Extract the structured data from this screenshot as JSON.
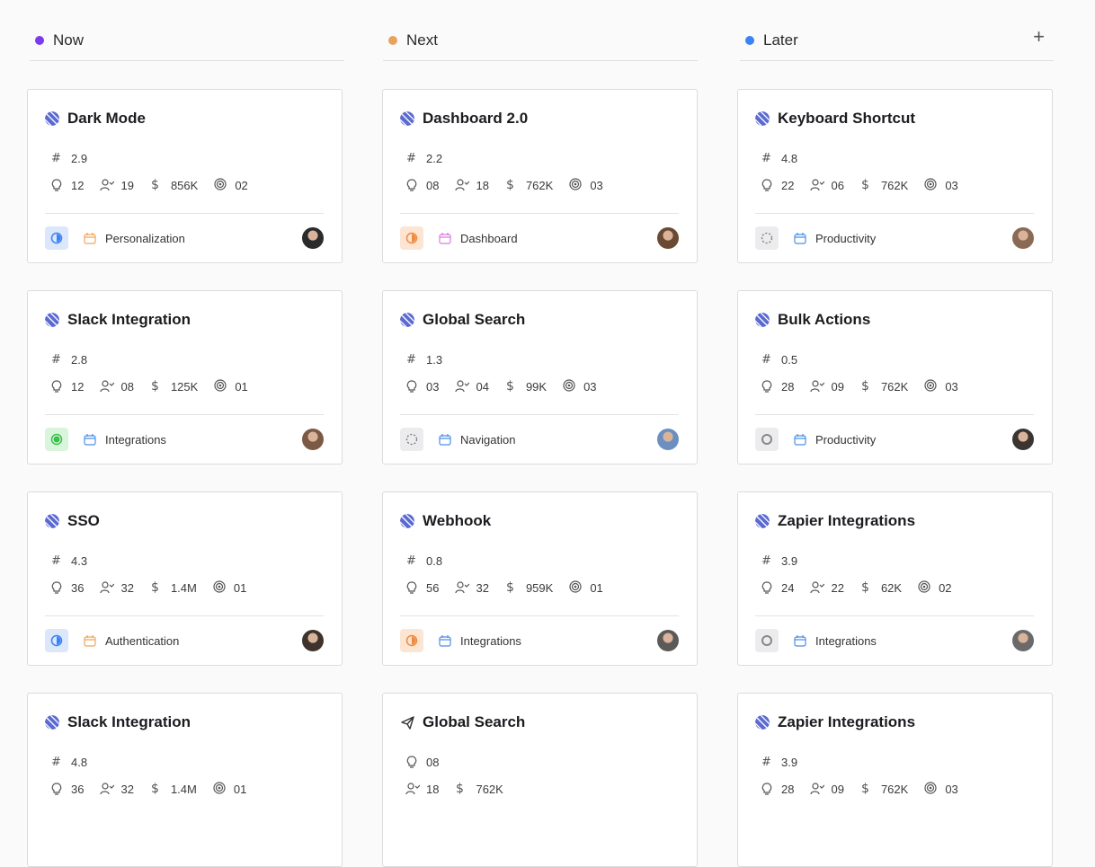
{
  "columns": [
    {
      "title": "Now",
      "color": "#7c3aed"
    },
    {
      "title": "Next",
      "color": "#e8a25c"
    },
    {
      "title": "Later",
      "color": "#3b82f6"
    }
  ],
  "add_icon": "plus-icon",
  "cards": [
    {
      "title": "Dark Mode",
      "score": "2.9",
      "ideas": "12",
      "users": "19",
      "revenue": "856K",
      "goals": "02",
      "tag": "Personalization",
      "status": "blue",
      "tag_color": "orange",
      "avatar": "#2b2b2b"
    },
    {
      "title": "Dashboard 2.0",
      "score": "2.2",
      "ideas": "08",
      "users": "18",
      "revenue": "762K",
      "goals": "03",
      "tag": "Dashboard",
      "status": "orange",
      "tag_color": "pink",
      "avatar": "#6a4a33"
    },
    {
      "title": "Keyboard Shortcut",
      "score": "4.8",
      "ideas": "22",
      "users": "06",
      "revenue": "762K",
      "goals": "03",
      "tag": "Productivity",
      "status": "dashed",
      "tag_color": "blue",
      "avatar": "#8a6a55"
    },
    {
      "title": "Slack Integration",
      "score": "2.8",
      "ideas": "12",
      "users": "08",
      "revenue": "125K",
      "goals": "01",
      "tag": "Integrations",
      "status": "green",
      "tag_color": "blue",
      "avatar": "#7a5a45"
    },
    {
      "title": "Global Search",
      "score": "1.3",
      "ideas": "03",
      "users": "04",
      "revenue": "99K",
      "goals": "03",
      "tag": "Navigation",
      "status": "dashed",
      "tag_color": "blue",
      "avatar": "#6b8fc0"
    },
    {
      "title": "Bulk Actions",
      "score": "0.5",
      "ideas": "28",
      "users": "09",
      "revenue": "762K",
      "goals": "03",
      "tag": "Productivity",
      "status": "gray",
      "tag_color": "blue",
      "avatar": "#3a3530"
    },
    {
      "title": "SSO",
      "score": "4.3",
      "ideas": "36",
      "users": "32",
      "revenue": "1.4M",
      "goals": "01",
      "tag": "Authentication",
      "status": "blue",
      "tag_color": "orange",
      "avatar": "#3d332c"
    },
    {
      "title": "Webhook",
      "score": "0.8",
      "ideas": "56",
      "users": "32",
      "revenue": "959K",
      "goals": "01",
      "tag": "Integrations",
      "status": "orange",
      "tag_color": "blue",
      "avatar": "#5c5a58"
    },
    {
      "title": "Zapier Integrations",
      "score": "3.9",
      "ideas": "24",
      "users": "22",
      "revenue": "62K",
      "goals": "02",
      "tag": "Integrations",
      "status": "gray",
      "tag_color": "blue",
      "avatar": "#6a6a6a"
    },
    {
      "title": "Slack Integration",
      "score": "4.8",
      "ideas": "36",
      "users": "32",
      "revenue": "1.4M",
      "goals": "01",
      "tag": "",
      "status": "blue",
      "tag_color": "blue",
      "avatar": "#333"
    },
    {
      "title": "Global Search",
      "score": "",
      "ideas": "08",
      "users": "18",
      "revenue": "762K",
      "goals": "",
      "tag": "",
      "status": "",
      "tag_color": "blue",
      "avatar": "#333",
      "variant": "stacked"
    },
    {
      "title": "Zapier Integrations",
      "score": "3.9",
      "ideas": "28",
      "users": "09",
      "revenue": "762K",
      "goals": "03",
      "tag": "",
      "status": "",
      "tag_color": "blue",
      "avatar": "#333"
    }
  ]
}
